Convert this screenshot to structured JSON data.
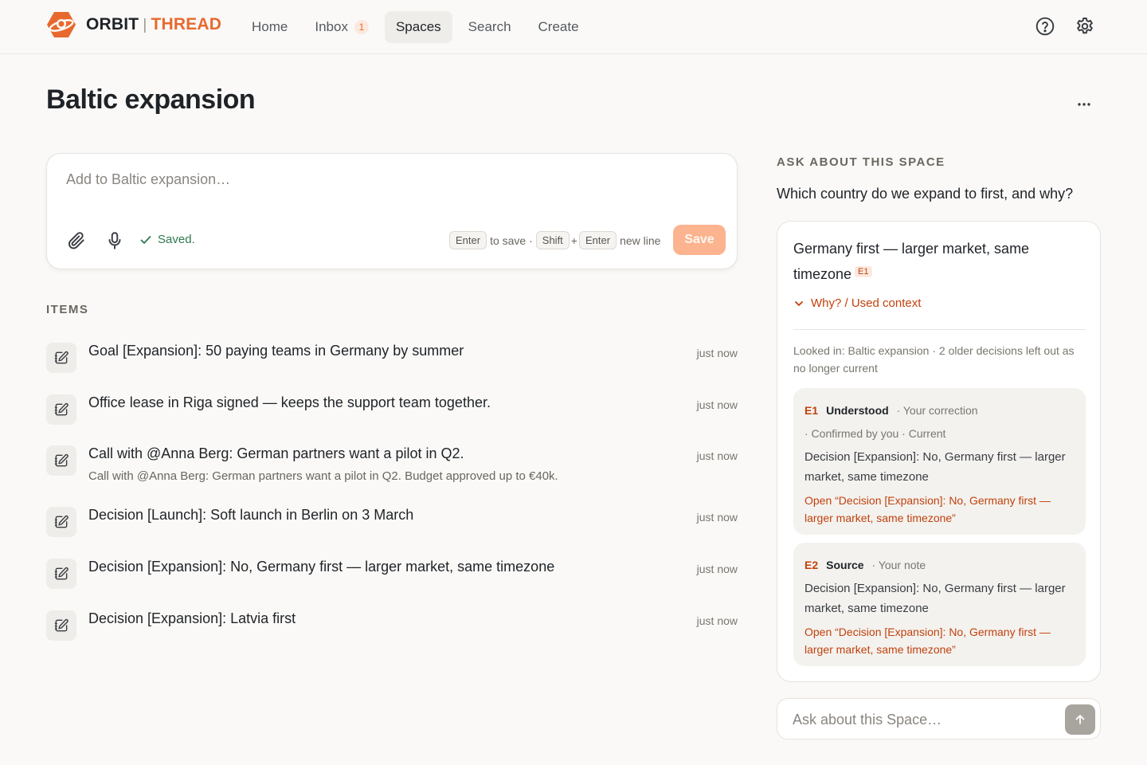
{
  "brand": {
    "name_a": "ORBIT",
    "sep": "|",
    "name_b": "THREAD",
    "accent": "#e8692e"
  },
  "nav": {
    "home": "Home",
    "inbox": "Inbox",
    "inbox_badge": "1",
    "spaces": "Spaces",
    "search": "Search",
    "create": "Create",
    "active": "Spaces"
  },
  "header_icons": [
    "help-icon",
    "gear-icon"
  ],
  "page": {
    "title": "Baltic expansion"
  },
  "composer": {
    "placeholder": "Add to Baltic expansion…",
    "value": "",
    "status": "Saved.",
    "kbd_enter": "Enter",
    "to_save": "to save ·",
    "kbd_shift": "Shift",
    "plus": "+",
    "kbd_enter2": "Enter",
    "new_line": "new line",
    "save_label": "Save"
  },
  "items_label": "ITEMS",
  "items": [
    {
      "title": "Goal [Expansion]: 50 paying teams in Germany by summer",
      "sub": "",
      "time": "just now"
    },
    {
      "title": "Office lease in Riga signed — keeps the support team together.",
      "sub": "",
      "time": "just now"
    },
    {
      "title": "Call with @Anna Berg: German partners want a pilot in Q2.",
      "sub": "Call with @Anna Berg: German partners want a pilot in Q2. Budget approved up to €40k.",
      "time": "just now"
    },
    {
      "title": "Decision [Launch]: Soft launch in Berlin on 3 March",
      "sub": "",
      "time": "just now"
    },
    {
      "title": "Decision [Expansion]: No, Germany first — larger market, same timezone",
      "sub": "",
      "time": "just now"
    },
    {
      "title": "Decision [Expansion]: Latvia first",
      "sub": "",
      "time": "just now"
    }
  ],
  "ask": {
    "label": "ASK ABOUT THIS SPACE",
    "question": "Which country do we expand to first, and why?",
    "answer": "Germany first — larger market, same timezone",
    "answer_ref": "E1",
    "why_label": "Why? / Used context",
    "looked_in": "Looked in: Baltic expansion · 2 older decisions left out as no longer current",
    "contexts": [
      {
        "id": "E1",
        "kind": "Understood",
        "meta1": "· Your correction",
        "meta2": "· Confirmed by you",
        "meta3": "· Current",
        "body": "Decision [Expansion]: No, Germany first — larger market, same timezone",
        "open": "Open “Decision [Expansion]: No, Germany first — larger market, same timezone”"
      },
      {
        "id": "E2",
        "kind": "Source",
        "meta1": "· Your note",
        "body": "Decision [Expansion]: No, Germany first — larger market, same timezone",
        "open": "Open “Decision [Expansion]: No, Germany first — larger market, same timezone”"
      }
    ],
    "input_placeholder": "Ask about this Space…"
  }
}
